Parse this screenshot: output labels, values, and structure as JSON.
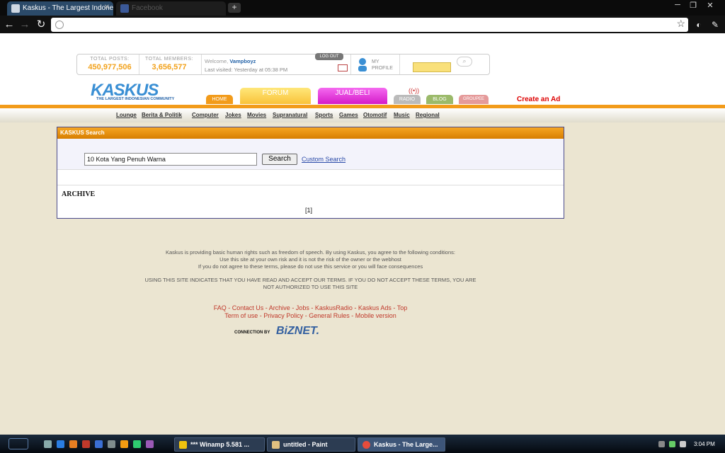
{
  "browser": {
    "tabs": [
      {
        "title": "Kaskus - The Largest Indonesi",
        "active": true
      },
      {
        "title": "Facebook",
        "active": false
      }
    ],
    "new_tab": "+",
    "window_controls": [
      "─",
      "❐",
      "✕"
    ],
    "address": ""
  },
  "header": {
    "total_posts_label": "TOTAL POSTS:",
    "total_posts": "450,977,506",
    "total_members_label": "TOTAL MEMBERS:",
    "total_members": "3,656,577",
    "welcome_prefix": "Welcome,",
    "username": "Vampboyz",
    "last_visited": "Last visited: Yesterday at 05:38 PM",
    "logout": "LOG OUT",
    "my_profile": "MY PROFILE",
    "logo": "KASKUS",
    "logo_tagline": "THE LARGEST INDONESIAN COMMUNITY",
    "nav_tabs": {
      "home": "HOME",
      "forum": "FORUM",
      "jual": "JUAL/BELI",
      "radio": "RADIO",
      "blog": "BLOG",
      "groupee": "GROUPEE"
    },
    "create_ad": "Create an Ad"
  },
  "categories": [
    "Lounge",
    "Berita & Politik",
    "Computer",
    "Jokes",
    "Movies",
    "Supranatural",
    "Sports",
    "Games",
    "Otomotif",
    "Music",
    "Regional"
  ],
  "search": {
    "title": "KASKUS Search",
    "query": "10 Kota Yang Penuh Warna",
    "button": "Search",
    "custom": "Custom Search",
    "archive": "ARCHIVE",
    "pager": "[1]"
  },
  "footer": {
    "line1": "Kaskus is providing basic human rights such as freedom of speech. By using Kaskus, you agree to the following conditions:",
    "line2": "Use this site at your own risk and it is not the risk of the owner or the webhost",
    "line3": "If you do not agree to these terms, please do not use this service or you will face consequences",
    "line4": "USING THIS SITE INDICATES THAT YOU HAVE READ AND ACCEPT OUR TERMS. IF YOU DO NOT ACCEPT THESE TERMS, YOU ARE",
    "line5": "NOT AUTHORIZED TO USE THIS SITE",
    "links1": "FAQ - Contact Us - Archive - Jobs - KaskusRadio - Kaskus Ads - Top",
    "links2": "Term of use - Privacy Policy - General Rules - Mobile version",
    "connection": "CONNECTION BY",
    "sponsor": "BiZNET."
  },
  "taskbar": {
    "tasks": [
      "*** Winamp 5.581 ...",
      "untitled - Paint",
      "Kaskus - The Large..."
    ],
    "clock": "3:04 PM"
  }
}
